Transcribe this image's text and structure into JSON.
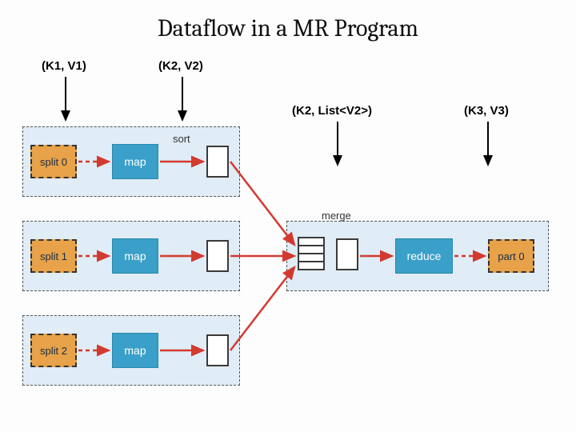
{
  "title": "Dataflow in a MR Program",
  "labels": {
    "k1v1": "(K1, V1)",
    "k2v2": "(K2, V2)",
    "k2list": "(K2, List<V2>)",
    "k3v3": "(K3, V3)"
  },
  "splits": [
    "split 0",
    "split 1",
    "split 2"
  ],
  "part": "part 0",
  "ops": {
    "map": "map",
    "reduce": "reduce",
    "sort": "sort",
    "merge": "merge"
  },
  "colors": {
    "split": "#e7a24a",
    "op": "#3aa0c9",
    "arrow": "#d33a2f",
    "group": "#cfe3f2"
  }
}
